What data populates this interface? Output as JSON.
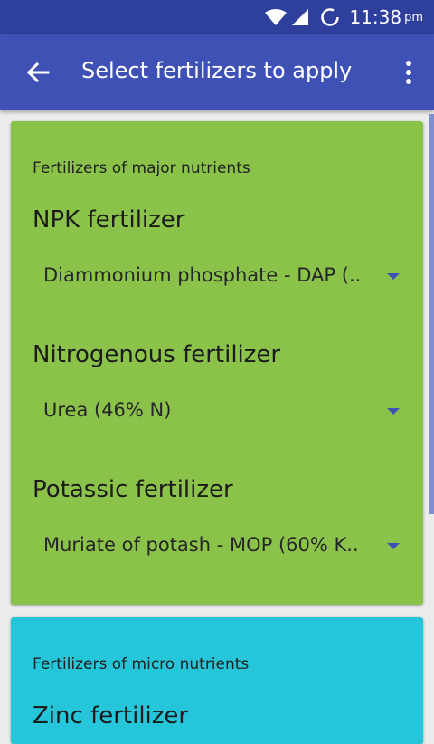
{
  "status_bar": {
    "time": "11:38",
    "ampm": "pm",
    "icons": [
      "wifi-icon",
      "cell-signal-icon",
      "sync-icon"
    ]
  },
  "app_bar": {
    "title": "Select fertilizers to apply",
    "back_icon": "arrow-back-icon",
    "menu_icon": "more-vert-icon"
  },
  "major_card": {
    "heading": "Fertilizers of major nutrients",
    "sections": [
      {
        "title": "NPK fertilizer",
        "selected": "Diammonium phosphate - DAP (.."
      },
      {
        "title": "Nitrogenous fertilizer",
        "selected": "Urea (46% N)"
      },
      {
        "title": "Potassic fertilizer",
        "selected": "Muriate of potash - MOP (60% K.."
      }
    ]
  },
  "micro_card": {
    "heading": "Fertilizers of micro nutrients",
    "sections": [
      {
        "title": "Zinc fertilizer"
      }
    ]
  },
  "colors": {
    "status_bar": "#2f3f9c",
    "app_bar": "#3f51b5",
    "major_card": "#8bc34a",
    "micro_card": "#26c6da"
  }
}
